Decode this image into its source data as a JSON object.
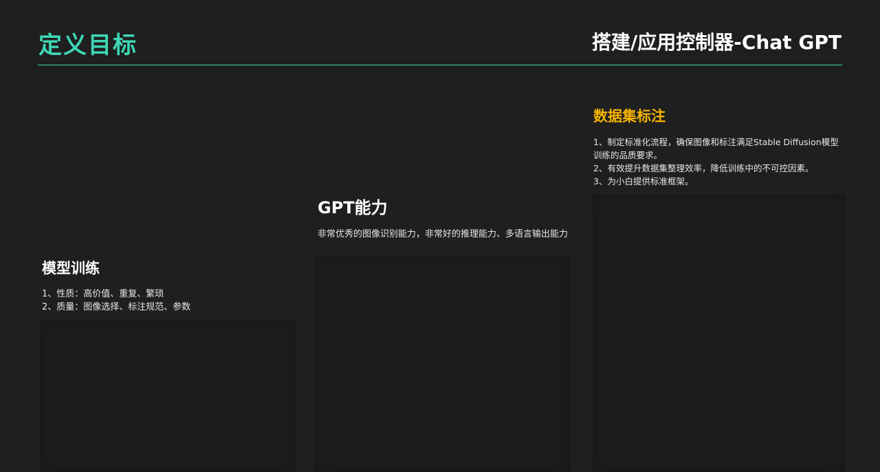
{
  "header": {
    "title": "定义目标",
    "subtitle": "搭建/应用控制器-Chat GPT"
  },
  "columns": [
    {
      "heading": "模型训练",
      "lines": [
        "1、性质：高价值、重复、繁琐",
        "2、质量：图像选择、标注规范、参数"
      ]
    },
    {
      "heading": "GPT能力",
      "lines": [
        "非常优秀的图像识别能力，非常好的推理能力、多语言输出能力"
      ]
    },
    {
      "heading": "数据集标注",
      "lines": [
        "1、制定标准化流程，确保图像和标注满足Stable Diffusion模型训练的品质要求。",
        "2、有效提升数据集整理效率，降低训练中的不可控因素。",
        "3、为小白提供标准框架。"
      ]
    }
  ],
  "colors": {
    "background": "#1f1f1f",
    "accent_green": "#3ed6b5",
    "accent_yellow": "#f5b400",
    "text": "#ffffff"
  }
}
